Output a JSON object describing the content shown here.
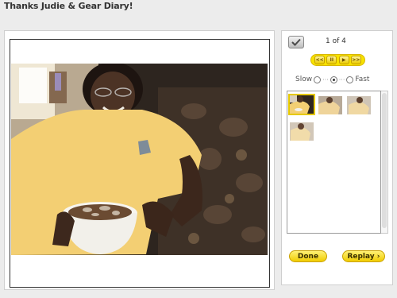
{
  "header": {
    "title": "Thanks Judie & Gear Diary!"
  },
  "viewer": {
    "photo_alt": "woman in yellow t-shirt holding a bowl, seated on a floral couch",
    "counter": "1 of 4"
  },
  "controls": {
    "first_glyph": "<<",
    "pause_glyph": "II",
    "next_glyph": "▶",
    "last_glyph": ">>"
  },
  "speed": {
    "slow_label": "Slow",
    "fast_label": "Fast",
    "separator": "···",
    "selected": "medium"
  },
  "thumbnails": {
    "count": 4,
    "selected_index": 0
  },
  "footer": {
    "done_label": "Done",
    "replay_label": "Replay ›"
  },
  "colors": {
    "accent": "#f0cc00",
    "shirt": "#f4cf75",
    "couch": "#3a2d25"
  }
}
